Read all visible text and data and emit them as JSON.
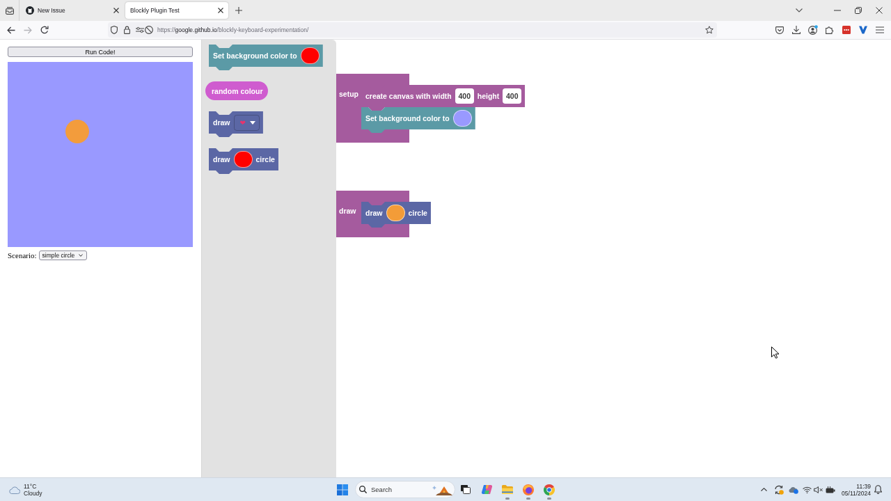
{
  "browser": {
    "tabs": [
      {
        "title": "New Issue",
        "favicon": true,
        "selected": false
      },
      {
        "title": "Blockly Plugin Test",
        "favicon": false,
        "selected": true
      }
    ],
    "nav_buttons": [
      {
        "kind": "back",
        "disabled": false
      },
      {
        "kind": "forward",
        "disabled": true
      },
      {
        "kind": "reload",
        "disabled": false
      }
    ],
    "address": {
      "scheme": "https://",
      "host": "google.github.io",
      "path": "/blockly-keyboard-experimentation/"
    }
  },
  "page": {
    "run_button": "Run Code!",
    "scenario": {
      "label": "Scenario:",
      "value": "simple circle"
    }
  },
  "blockly": {
    "flyout": [
      {
        "kind": "statement",
        "color": "#5b9aa6",
        "fields": [
          {
            "kind": "label",
            "text": "Set background color to"
          },
          {
            "kind": "colour",
            "color": "#ff0000"
          }
        ]
      },
      {
        "kind": "value",
        "color": "#cf5ccf",
        "fields": [
          {
            "kind": "label",
            "text": "random colour"
          }
        ]
      },
      {
        "kind": "statement",
        "color": "#5b67a5",
        "fields": [
          {
            "kind": "label",
            "text": "draw"
          },
          {
            "kind": "dropdown",
            "value": "❤"
          }
        ]
      },
      {
        "kind": "statement",
        "color": "#5b67a5",
        "fields": [
          {
            "kind": "label",
            "text": "draw"
          },
          {
            "kind": "colour",
            "color": "#ff0000"
          },
          {
            "kind": "label",
            "text": "circle"
          }
        ]
      }
    ],
    "workspace": [
      {
        "kind": "container",
        "color": "#a55b9e",
        "label": "setup",
        "children": [
          {
            "kind": "statement",
            "color": "#a55b9e",
            "fields": [
              {
                "kind": "label",
                "text": "create canvas with width"
              },
              {
                "kind": "number",
                "value": "400"
              },
              {
                "kind": "label",
                "text": "height"
              },
              {
                "kind": "number",
                "value": "400"
              }
            ]
          },
          {
            "kind": "statement",
            "color": "#5b9aa6",
            "fields": [
              {
                "kind": "label",
                "text": "Set background color to"
              },
              {
                "kind": "colour",
                "color": "#9999ff"
              }
            ]
          }
        ]
      },
      {
        "kind": "container",
        "color": "#a55b9e",
        "label": "draw",
        "children": [
          {
            "kind": "statement",
            "color": "#5b67a5",
            "fields": [
              {
                "kind": "label",
                "text": "draw"
              },
              {
                "kind": "colour",
                "color": "#f39c38"
              },
              {
                "kind": "label",
                "text": "circle"
              }
            ]
          }
        ]
      }
    ]
  },
  "taskbar": {
    "weather": {
      "temperature": "11°C",
      "condition": "Cloudy"
    },
    "search": {
      "placeholder": "Search"
    },
    "apps": [
      {
        "kind": "task_view",
        "running": false
      },
      {
        "kind": "copilot",
        "running": false
      },
      {
        "kind": "files",
        "running": true
      },
      {
        "kind": "firefox",
        "running": true
      },
      {
        "kind": "chrome",
        "running": true
      }
    ],
    "clock": {
      "time": "11:39",
      "date": "05/11/2024"
    }
  }
}
